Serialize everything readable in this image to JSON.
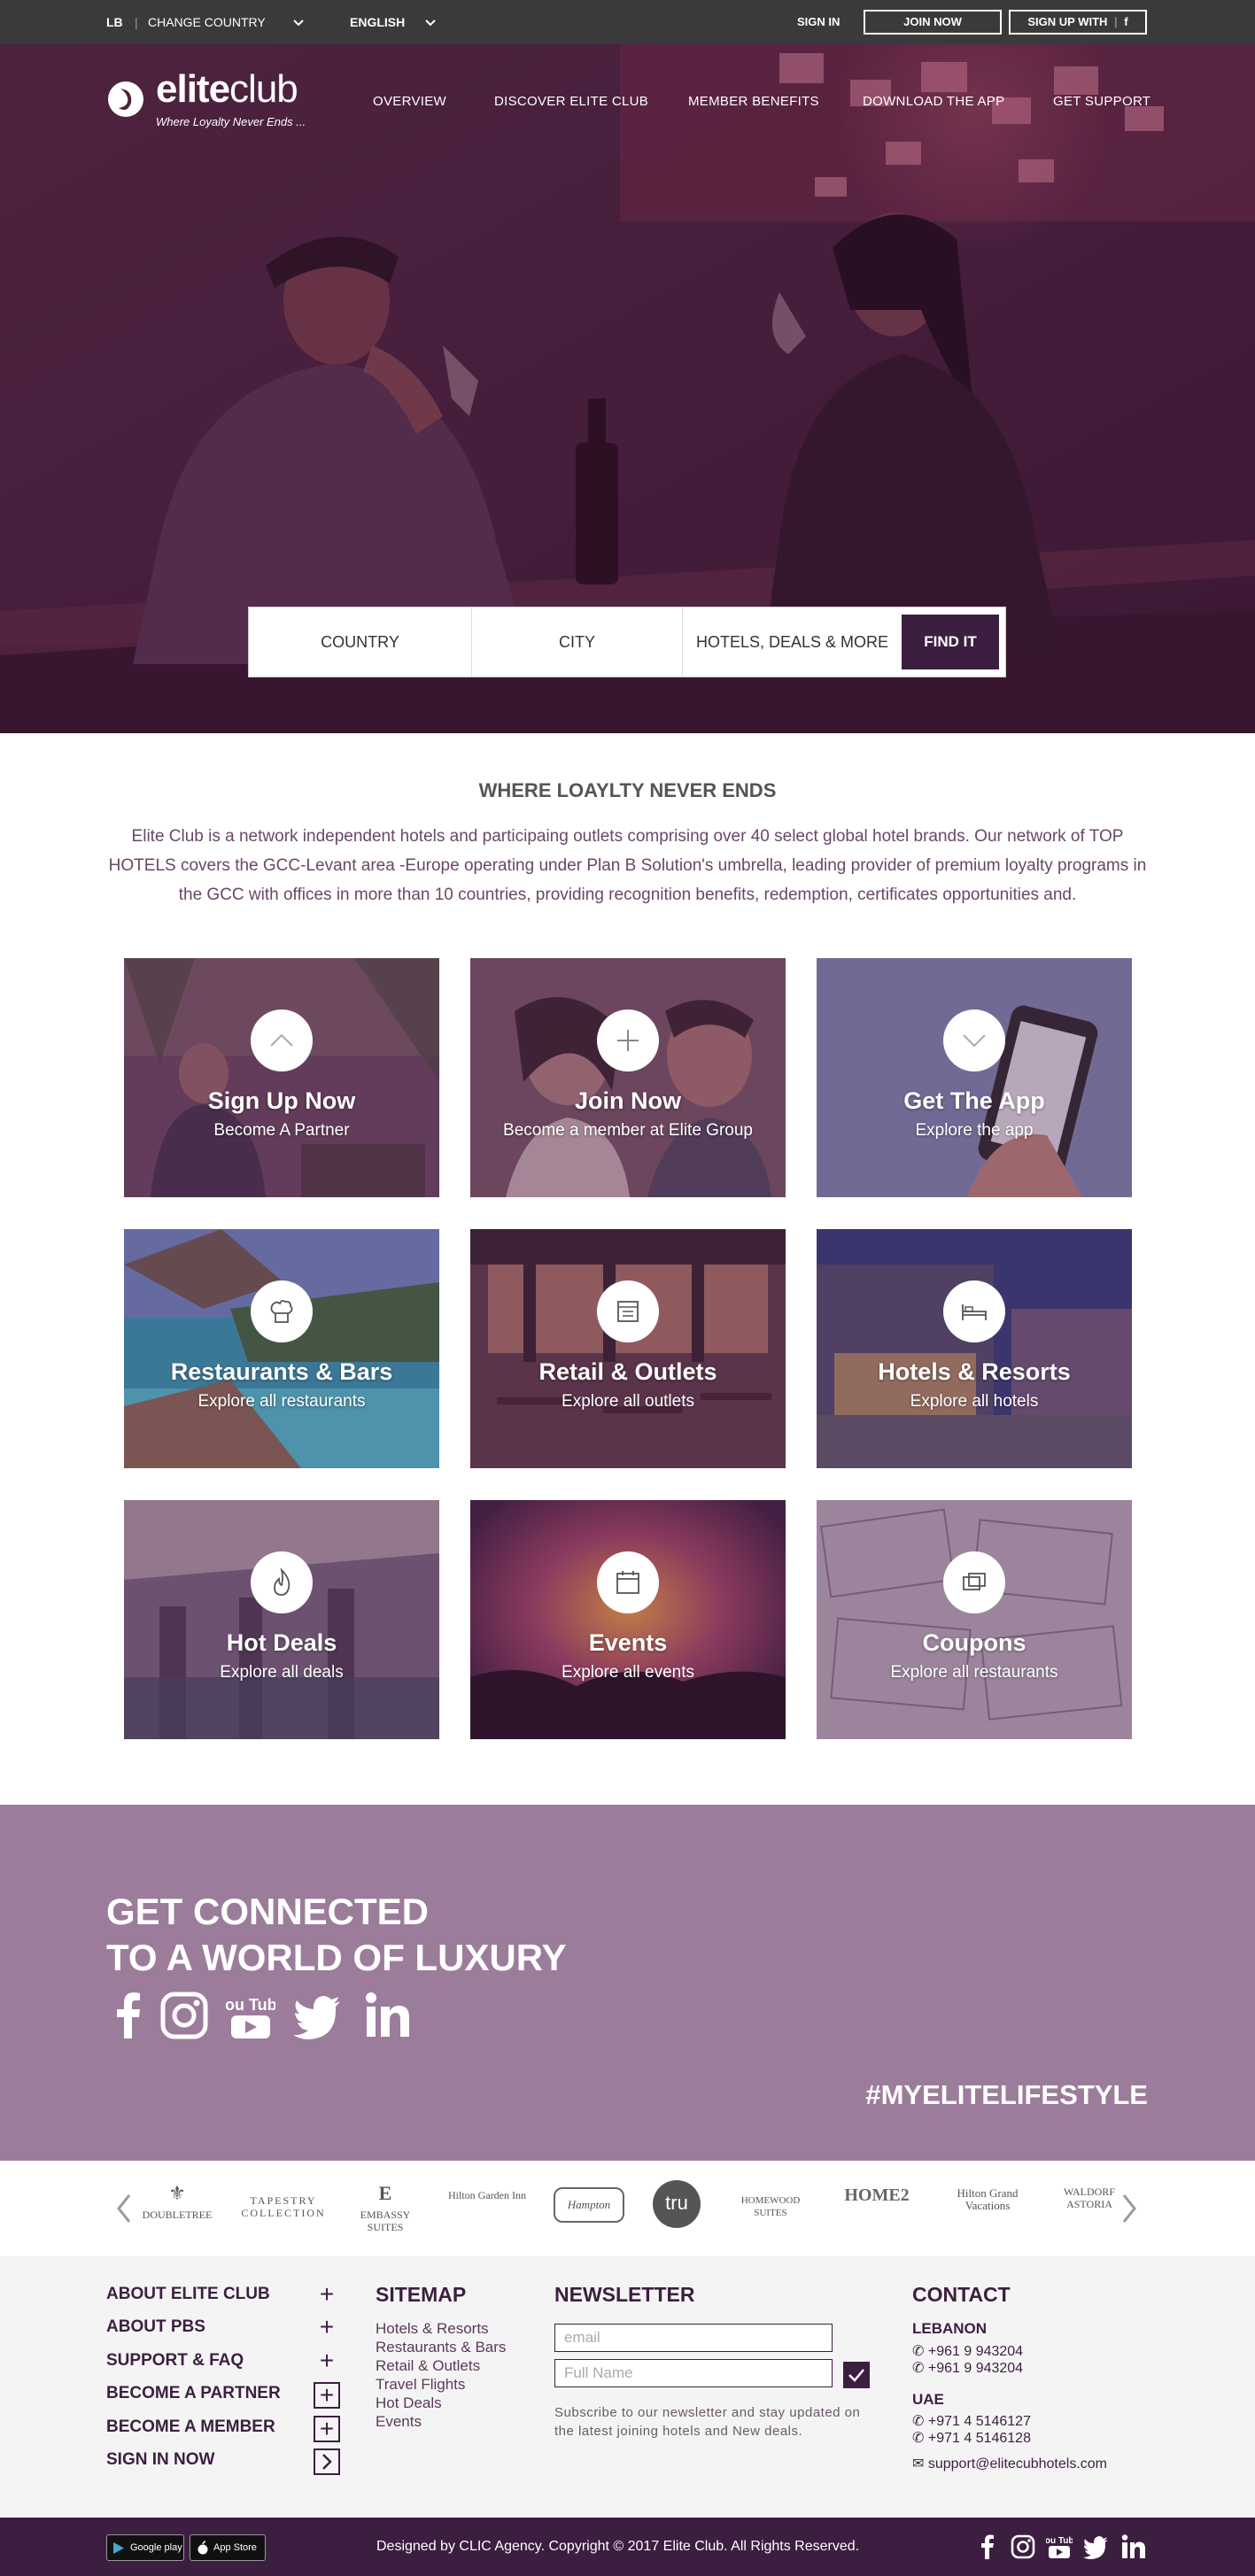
{
  "topbar": {
    "country_code": "LB",
    "change_country": "CHANGE COUNTRY",
    "language": "ENGLISH",
    "sign_in": "SIGN IN",
    "join_now": "JOIN NOW",
    "sign_up_with": "SIGN UP WITH",
    "sign_up_icon": "f"
  },
  "logo": {
    "name_part1": "elite",
    "name_part2": "club",
    "tagline": "Where Loyalty Never Ends ..."
  },
  "nav": [
    "OVERVIEW",
    "DISCOVER ELITE CLUB",
    "MEMBER BENEFITS",
    "DOWNLOAD THE APP",
    "GET SUPPORT"
  ],
  "search": {
    "country": "COUNTRY",
    "city": "CITY",
    "hotels": "HOTELS, DEALS & MORE",
    "button": "FIND IT"
  },
  "intro": {
    "heading": "WHERE LOAYLTY NEVER ENDS",
    "text": "Elite Club is a network independent hotels and participaing outlets comprising over 40 select global hotel brands. Our network of TOP HOTELS covers the GCC-Levant area -Europe operating under Plan B Solution's umbrella, leading provider of premium loyalty programs in the GCC with offices in more than 10 countries, providing recognition benefits, redemption, certificates opportunities and."
  },
  "tiles": [
    {
      "title": "Sign Up Now",
      "subtitle": "Become A Partner",
      "icon": "chevron-up-icon"
    },
    {
      "title": "Join Now",
      "subtitle": "Become a member at Elite Group",
      "icon": "plus-icon"
    },
    {
      "title": "Get The App",
      "subtitle": "Explore the app",
      "icon": "chevron-down-icon"
    },
    {
      "title": "Restaurants & Bars",
      "subtitle": "Explore all restaurants",
      "icon": "chef-hat-icon"
    },
    {
      "title": "Retail & Outlets",
      "subtitle": "Explore all outlets",
      "icon": "shop-icon"
    },
    {
      "title": "Hotels & Resorts",
      "subtitle": "Explore all hotels",
      "icon": "bed-icon"
    },
    {
      "title": "Hot Deals",
      "subtitle": "Explore all deals",
      "icon": "flame-icon"
    },
    {
      "title": "Events",
      "subtitle": "Explore all events",
      "icon": "calendar-icon"
    },
    {
      "title": "Coupons",
      "subtitle": "Explore all restaurants",
      "icon": "coupon-icon"
    }
  ],
  "connected": {
    "line1": "GET CONNECTED",
    "line2": "TO A WORLD OF LUXURY",
    "hashtag": "#MYELITELIFESTYLE",
    "socials": [
      "facebook-icon",
      "instagram-icon",
      "youtube-icon",
      "twitter-icon",
      "linkedin-icon"
    ],
    "youtube_label": "You Tube"
  },
  "brands": [
    "DOUBLETREE",
    "TAPESTRY COLLECTION",
    "EMBASSY SUITES",
    "Hilton Garden Inn",
    "Hampton",
    "tru",
    "HOMEWOOD SUITES",
    "HOME2",
    "Hilton Grand Vacations",
    "WALDORF ASTORIA"
  ],
  "footer": {
    "links": [
      "ABOUT ELITE CLUB",
      "ABOUT PBS",
      "SUPPORT & FAQ",
      "BECOME A PARTNER",
      "BECOME A MEMBER",
      "SIGN IN NOW"
    ],
    "sitemap_title": "SITEMAP",
    "sitemap": [
      "Hotels & Resorts",
      "Restaurants & Bars",
      "Retail & Outlets",
      "Travel Flights",
      "Hot Deals",
      "Events"
    ],
    "newsletter_title": "NEWSLETTER",
    "email_placeholder": "email",
    "name_placeholder": "Full Name",
    "newsletter_text": "Subscribe to our newsletter and stay updated on the latest joining hotels and New deals.",
    "contact_title": "CONTACT",
    "lebanon": "LEBANON",
    "lebanon_phones": [
      "+961 9 943204",
      "+961 9 943204"
    ],
    "uae": "UAE",
    "uae_phones": [
      "+971 4 5146127",
      "+971 4 5146128"
    ],
    "email": "support@elitecubhotels.com"
  },
  "bottom": {
    "google_play": "Google play",
    "app_store": "App Store",
    "copyright": "Designed by CLIC Agency. Copyright © 2017 Elite Club. All Rights Reserved.",
    "youtube_label": "You Tube"
  },
  "colors": {
    "brand": "#3c1f40",
    "accent": "#9c7c9b",
    "topbar": "#3a3a3a"
  }
}
